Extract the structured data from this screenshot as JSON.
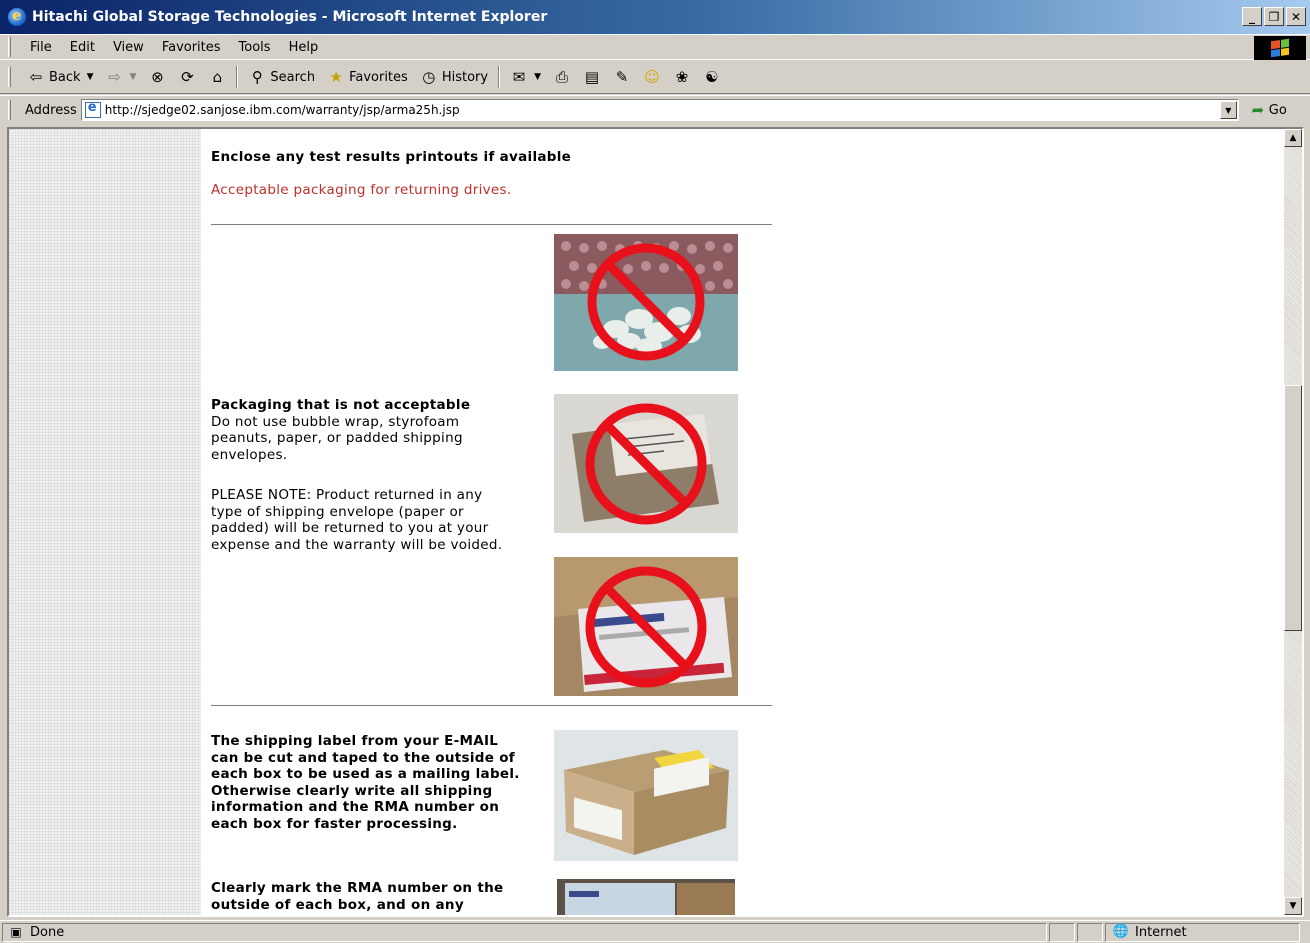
{
  "window": {
    "title": "Hitachi Global Storage Technologies - Microsoft Internet Explorer"
  },
  "menu": [
    "File",
    "Edit",
    "View",
    "Favorites",
    "Tools",
    "Help"
  ],
  "toolbar": {
    "back": "Back",
    "search": "Search",
    "favorites": "Favorites",
    "history": "History"
  },
  "address": {
    "label": "Address",
    "url": "http://sjedge02.sanjose.ibm.com/warranty/jsp/arma25h.jsp",
    "go": "Go"
  },
  "page": {
    "heading": "Enclose any test results printouts if available",
    "link": "Acceptable packaging for returning drives.",
    "not_acceptable_title": "Packaging that is not acceptable",
    "not_acceptable_body": "Do not use bubble wrap, styrofoam peanuts, paper, or padded shipping envelopes.",
    "note": "PLEASE NOTE: Product returned in any type of shipping envelope (paper or padded) will be returned to you at your expense and the warranty will be voided.",
    "label_text": "The shipping label from your E-MAIL can be cut and taped to the outside of each box to be used as a mailing label. Otherwise clearly write all shipping information and the RMA number on each box for faster processing.",
    "mark_text": "Clearly mark the RMA number on the outside of each box, and on any"
  },
  "status": {
    "text": "Done",
    "zone": "Internet"
  },
  "colors": {
    "link": "#c0302c",
    "titlebar_start": "#0a246a",
    "no_symbol": "#e8101a"
  }
}
